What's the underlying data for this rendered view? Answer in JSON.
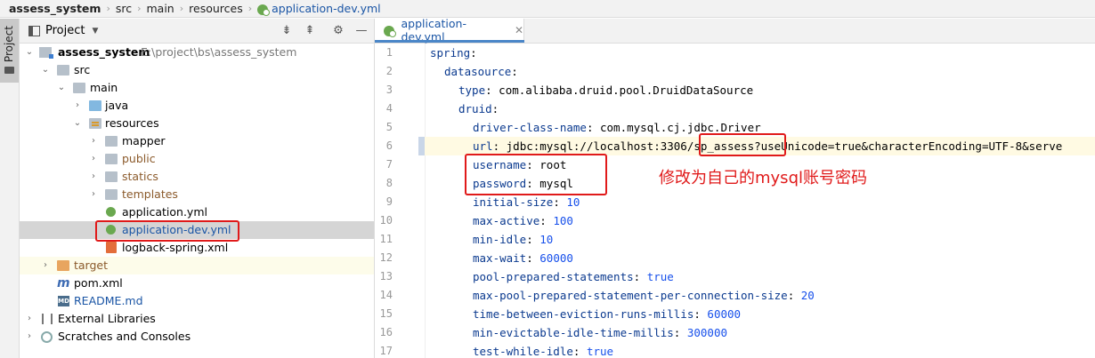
{
  "breadcrumb": {
    "items": [
      "assess_system",
      "src",
      "main",
      "resources"
    ],
    "file": "application-dev.yml"
  },
  "stripe": {
    "label": "Project"
  },
  "project_panel": {
    "title": "Project",
    "tree": [
      {
        "label": "assess_system",
        "path": "E:\\project\\bs\\assess_system",
        "icon": "module-folder-icon"
      },
      {
        "label": "src",
        "icon": "folder-icon"
      },
      {
        "label": "main",
        "icon": "folder-icon"
      },
      {
        "label": "java",
        "icon": "source-folder-icon"
      },
      {
        "label": "resources",
        "icon": "resources-folder-icon"
      },
      {
        "label": "mapper",
        "icon": "folder-icon"
      },
      {
        "label": "public",
        "icon": "folder-icon"
      },
      {
        "label": "statics",
        "icon": "folder-icon"
      },
      {
        "label": "templates",
        "icon": "folder-icon"
      },
      {
        "label": "application.yml",
        "icon": "yaml-file-icon"
      },
      {
        "label": "application-dev.yml",
        "icon": "yaml-file-icon"
      },
      {
        "label": "logback-spring.xml",
        "icon": "xml-file-icon"
      },
      {
        "label": "target",
        "icon": "excluded-folder-icon"
      },
      {
        "label": "pom.xml",
        "icon": "maven-file-icon"
      },
      {
        "label": "README.md",
        "icon": "markdown-file-icon"
      },
      {
        "label": "External Libraries",
        "icon": "libraries-icon"
      },
      {
        "label": "Scratches and Consoles",
        "icon": "scratches-icon"
      }
    ]
  },
  "editor": {
    "tab": "application-dev.yml",
    "line_numbers": [
      "1",
      "2",
      "3",
      "4",
      "5",
      "6",
      "7",
      "8",
      "9",
      "10",
      "11",
      "12",
      "13",
      "14",
      "15",
      "16",
      "17"
    ],
    "lines": [
      {
        "key": "spring",
        "val": ""
      },
      {
        "key": "datasource",
        "val": ""
      },
      {
        "key": "type",
        "val": "com.alibaba.druid.pool.DruidDataSource"
      },
      {
        "key": "druid",
        "val": ""
      },
      {
        "key": "driver-class-name",
        "val": "com.mysql.cj.jdbc.Driver"
      },
      {
        "key": "url",
        "val": "jdbc:mysql://localhost:3306/sp_assess?useUnicode=true&characterEncoding=UTF-8&serve"
      },
      {
        "key": "username",
        "val": "root"
      },
      {
        "key": "password",
        "val": "mysql"
      },
      {
        "key": "initial-size",
        "val": "10"
      },
      {
        "key": "max-active",
        "val": "100"
      },
      {
        "key": "min-idle",
        "val": "10"
      },
      {
        "key": "max-wait",
        "val": "60000"
      },
      {
        "key": "pool-prepared-statements",
        "val": "true"
      },
      {
        "key": "max-pool-prepared-statement-per-connection-size",
        "val": "20"
      },
      {
        "key": "time-between-eviction-runs-millis",
        "val": "60000"
      },
      {
        "key": "min-evictable-idle-time-millis",
        "val": "300000"
      },
      {
        "key": "test-while-idle",
        "val": "true"
      }
    ]
  },
  "annotation": {
    "text": "修改为自己的mysql账号密码",
    "color": "#e01a1a"
  }
}
